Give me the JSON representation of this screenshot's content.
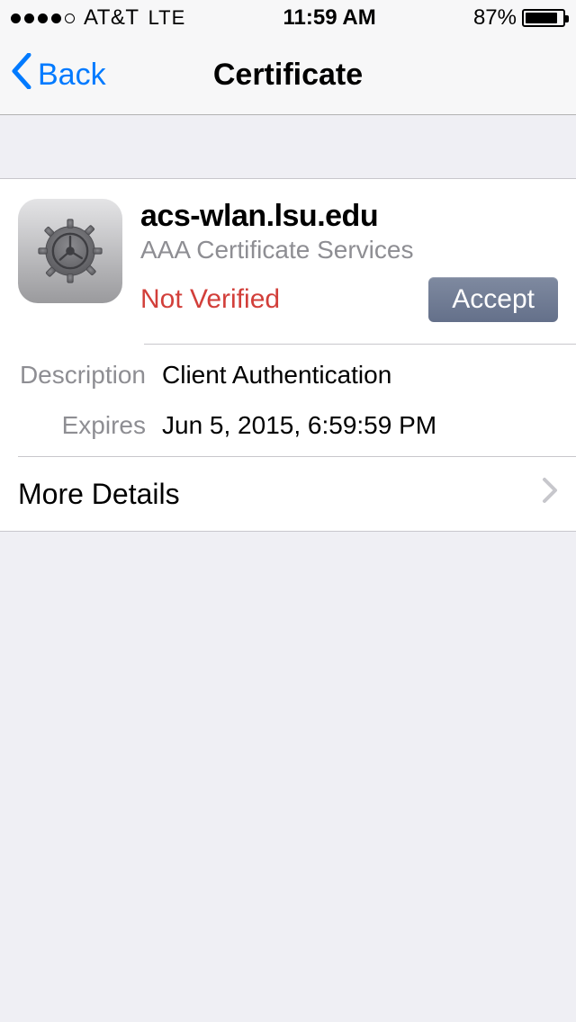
{
  "status": {
    "carrier": "AT&T",
    "network": "LTE",
    "time": "11:59 AM",
    "battery_pct": "87%"
  },
  "nav": {
    "back_label": "Back",
    "title": "Certificate"
  },
  "cert": {
    "host": "acs-wlan.lsu.edu",
    "issuer": "AAA Certificate Services",
    "status": "Not Verified",
    "accept_label": "Accept",
    "description_label": "Description",
    "description_value": "Client Authentication",
    "expires_label": "Expires",
    "expires_value": "Jun 5, 2015, 6:59:59 PM",
    "more_label": "More Details"
  }
}
